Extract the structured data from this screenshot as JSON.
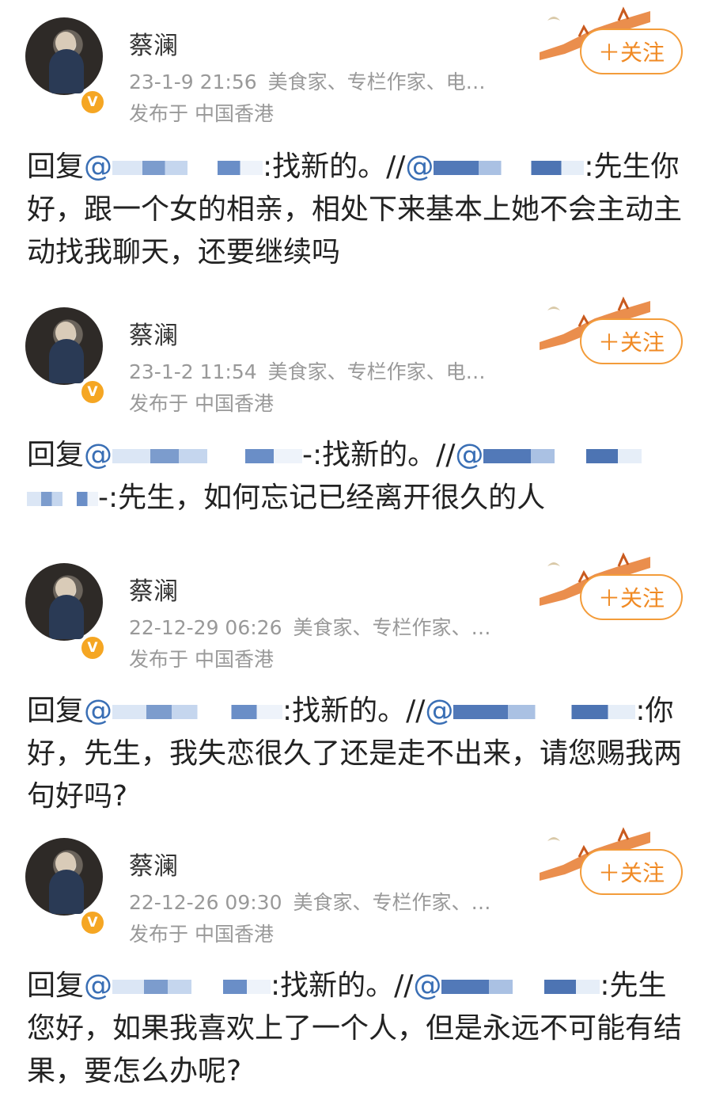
{
  "posts": [
    {
      "author": "蔡澜",
      "time": "23-1-9 21:56",
      "tags": "美食家、专栏作家、电…",
      "location": "发布于 中国香港",
      "follow": "＋关注",
      "reply_prefix": "回复",
      "at": "@",
      "reply_text": ":找新的。//",
      "at2": "@",
      "question": ":先生你好，跟一个女的相亲，相处下来基本上她不会主动主动找我聊天，还要继续吗"
    },
    {
      "author": "蔡澜",
      "time": "23-1-2 11:54",
      "tags": "美食家、专栏作家、电…",
      "location": "发布于 中国香港",
      "follow": "＋关注",
      "reply_prefix": "回复",
      "at": "@",
      "reply_text": "-:找新的。//",
      "at2": "@",
      "question": "-:先生，如何忘记已经离开很久的人"
    },
    {
      "author": "蔡澜",
      "time": "22-12-29 06:26",
      "tags": "美食家、专栏作家、…",
      "location": "发布于 中国香港",
      "follow": "＋关注",
      "reply_prefix": "回复",
      "at": "@",
      "reply_text": ":找新的。//",
      "at2": "@",
      "question": ":你好，先生，我失恋很久了还是走不出来，请您赐我两句好吗?"
    },
    {
      "author": "蔡澜",
      "time": "22-12-26 09:30",
      "tags": "美食家、专栏作家、…",
      "location": "发布于 中国香港",
      "follow": "＋关注",
      "reply_prefix": "回复",
      "at": "@",
      "reply_text": ":找新的。//",
      "at2": "@",
      "question": ":先生您好，如果我喜欢上了一个人，但是永远不可能有结果，要怎么办呢?"
    }
  ],
  "colors": {
    "accent": "#f08a24",
    "mention": "#3a6fb5",
    "meta": "#999999",
    "badge": "#f5a623"
  },
  "icons": {
    "verified": "verified-badge-icon",
    "decoration": "great-wall-dove-icon"
  }
}
